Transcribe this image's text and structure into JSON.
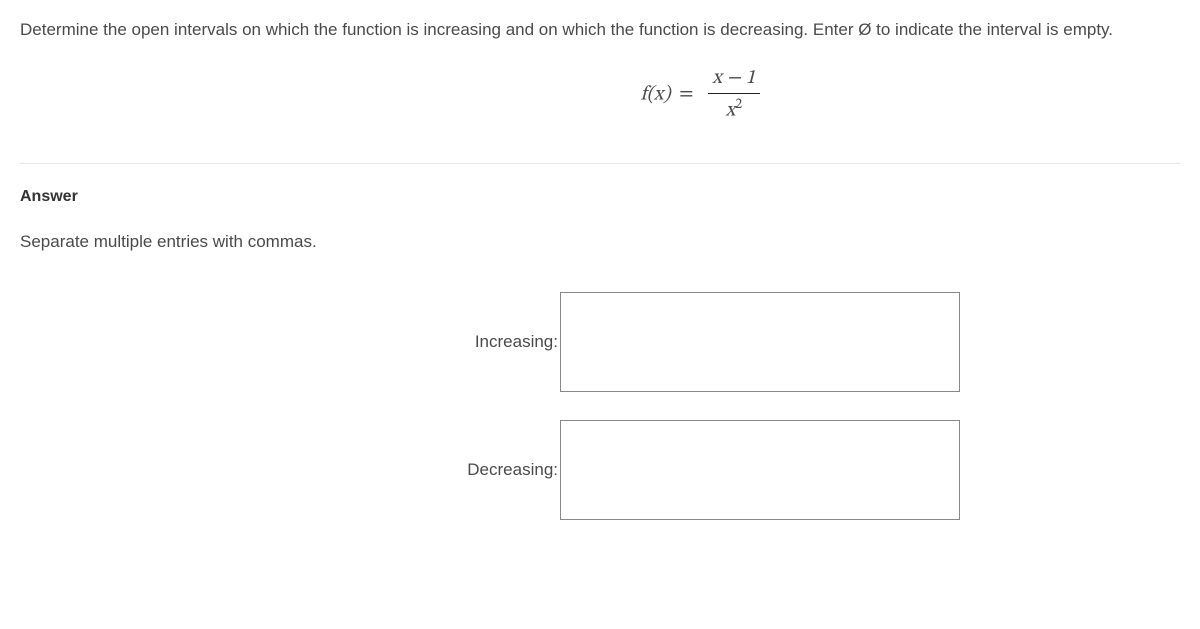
{
  "question": {
    "prompt": "Determine the open intervals on which the function is increasing and on which the function is decreasing. Enter Ø to indicate the interval is empty.",
    "formula_lhs": "f(x)",
    "formula_eq": "=",
    "formula_num": "x − 1",
    "formula_den_base": "x",
    "formula_den_exp": "2"
  },
  "answer": {
    "heading": "Answer",
    "instructions": "Separate multiple entries with commas.",
    "increasing_label": "Increasing:",
    "decreasing_label": "Decreasing:",
    "increasing_value": "",
    "decreasing_value": ""
  }
}
